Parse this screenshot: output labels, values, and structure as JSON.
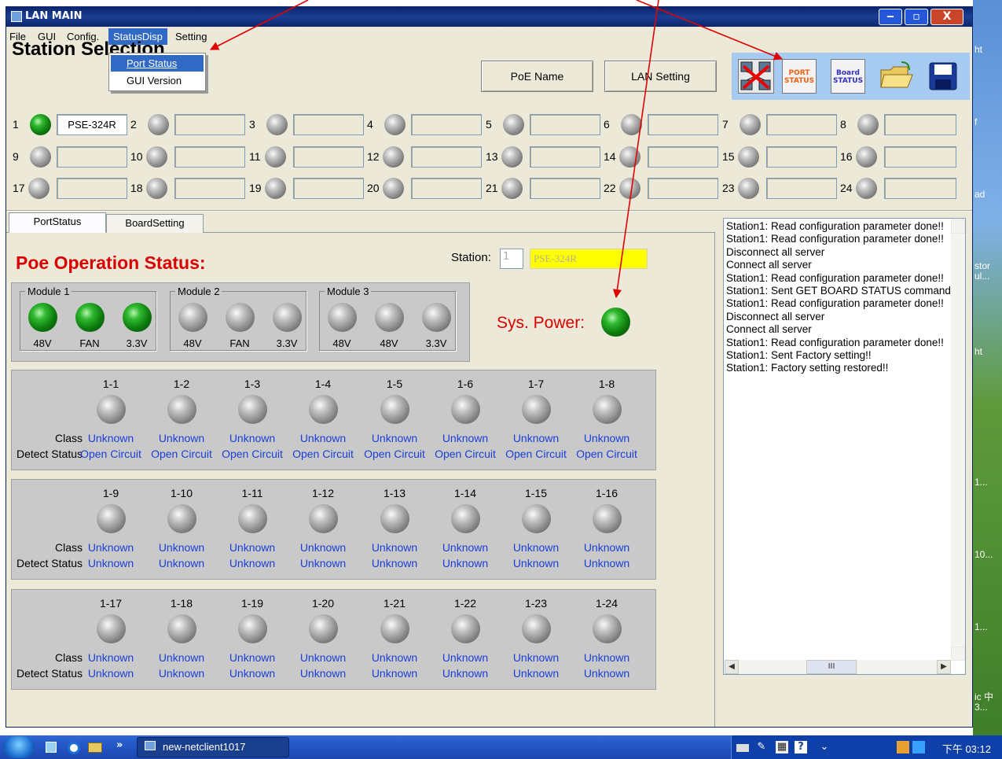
{
  "window": {
    "title": "LAN MAIN",
    "buttons": {
      "minimize": "‒",
      "maximize": "▫",
      "close": "X"
    }
  },
  "menu": {
    "items": [
      {
        "label": "File"
      },
      {
        "label": "GUI"
      },
      {
        "label": "Config."
      },
      {
        "label": "StatusDisp"
      },
      {
        "label": "Setting"
      }
    ],
    "dropdown": [
      {
        "label": "Port Status"
      },
      {
        "label": "GUI Version"
      }
    ]
  },
  "station_selection": {
    "title": "Station Selection",
    "poe_name_button": "PoE Name",
    "lan_setting_button": "LAN Setting",
    "toolbar": {
      "port_status": "PORT STATUS",
      "board_status": "Board STATUS"
    },
    "stations": [
      {
        "num": "1",
        "name": "PSE-324R",
        "on": true
      },
      {
        "num": "2",
        "name": "",
        "on": false
      },
      {
        "num": "3",
        "name": "",
        "on": false
      },
      {
        "num": "4",
        "name": "",
        "on": false
      },
      {
        "num": "5",
        "name": "",
        "on": false
      },
      {
        "num": "6",
        "name": "",
        "on": false
      },
      {
        "num": "7",
        "name": "",
        "on": false
      },
      {
        "num": "8",
        "name": "",
        "on": false
      },
      {
        "num": "9",
        "name": "",
        "on": false
      },
      {
        "num": "10",
        "name": "",
        "on": false
      },
      {
        "num": "11",
        "name": "",
        "on": false
      },
      {
        "num": "12",
        "name": "",
        "on": false
      },
      {
        "num": "13",
        "name": "",
        "on": false
      },
      {
        "num": "14",
        "name": "",
        "on": false
      },
      {
        "num": "15",
        "name": "",
        "on": false
      },
      {
        "num": "16",
        "name": "",
        "on": false
      },
      {
        "num": "17",
        "name": "",
        "on": false
      },
      {
        "num": "18",
        "name": "",
        "on": false
      },
      {
        "num": "19",
        "name": "",
        "on": false
      },
      {
        "num": "20",
        "name": "",
        "on": false
      },
      {
        "num": "21",
        "name": "",
        "on": false
      },
      {
        "num": "22",
        "name": "",
        "on": false
      },
      {
        "num": "23",
        "name": "",
        "on": false
      },
      {
        "num": "24",
        "name": "",
        "on": false
      }
    ]
  },
  "tabs": [
    {
      "label": "PortStatus"
    },
    {
      "label": "BoardSetting"
    }
  ],
  "poe_status": {
    "title": "Poe Operation Status:",
    "station_label": "Station:",
    "station_num": "1",
    "station_name": "PSE-324R",
    "sys_power_label": "Sys. Power:",
    "modules": [
      {
        "name": "Module 1",
        "leds": [
          {
            "label": "48V",
            "on": true
          },
          {
            "label": "FAN",
            "on": true
          },
          {
            "label": "3.3V",
            "on": true
          }
        ]
      },
      {
        "name": "Module 2",
        "leds": [
          {
            "label": "48V",
            "on": false
          },
          {
            "label": "FAN",
            "on": false
          },
          {
            "label": "3.3V",
            "on": false
          }
        ]
      },
      {
        "name": "Module 3",
        "leds": [
          {
            "label": "48V",
            "on": false
          },
          {
            "label": "48V",
            "on": false
          },
          {
            "label": "3.3V",
            "on": false
          }
        ]
      }
    ],
    "row_labels": {
      "class": "Class",
      "detect": "Detect Status"
    },
    "port_groups": [
      {
        "ports": [
          {
            "id": "1-1",
            "class": "Unknown",
            "detect": "Open Circuit"
          },
          {
            "id": "1-2",
            "class": "Unknown",
            "detect": "Open Circuit"
          },
          {
            "id": "1-3",
            "class": "Unknown",
            "detect": "Open Circuit"
          },
          {
            "id": "1-4",
            "class": "Unknown",
            "detect": "Open Circuit"
          },
          {
            "id": "1-5",
            "class": "Unknown",
            "detect": "Open Circuit"
          },
          {
            "id": "1-6",
            "class": "Unknown",
            "detect": "Open Circuit"
          },
          {
            "id": "1-7",
            "class": "Unknown",
            "detect": "Open Circuit"
          },
          {
            "id": "1-8",
            "class": "Unknown",
            "detect": "Open Circuit"
          }
        ]
      },
      {
        "ports": [
          {
            "id": "1-9",
            "class": "Unknown",
            "detect": "Unknown"
          },
          {
            "id": "1-10",
            "class": "Unknown",
            "detect": "Unknown"
          },
          {
            "id": "1-11",
            "class": "Unknown",
            "detect": "Unknown"
          },
          {
            "id": "1-12",
            "class": "Unknown",
            "detect": "Unknown"
          },
          {
            "id": "1-13",
            "class": "Unknown",
            "detect": "Unknown"
          },
          {
            "id": "1-14",
            "class": "Unknown",
            "detect": "Unknown"
          },
          {
            "id": "1-15",
            "class": "Unknown",
            "detect": "Unknown"
          },
          {
            "id": "1-16",
            "class": "Unknown",
            "detect": "Unknown"
          }
        ]
      },
      {
        "ports": [
          {
            "id": "1-17",
            "class": "Unknown",
            "detect": "Unknown"
          },
          {
            "id": "1-18",
            "class": "Unknown",
            "detect": "Unknown"
          },
          {
            "id": "1-19",
            "class": "Unknown",
            "detect": "Unknown"
          },
          {
            "id": "1-20",
            "class": "Unknown",
            "detect": "Unknown"
          },
          {
            "id": "1-21",
            "class": "Unknown",
            "detect": "Unknown"
          },
          {
            "id": "1-22",
            "class": "Unknown",
            "detect": "Unknown"
          },
          {
            "id": "1-23",
            "class": "Unknown",
            "detect": "Unknown"
          },
          {
            "id": "1-24",
            "class": "Unknown",
            "detect": "Unknown"
          }
        ]
      }
    ]
  },
  "log": [
    "Station1: Read configuration parameter done!!",
    "Station1: Read configuration parameter done!!",
    "Disconnect all server",
    "Connect all server",
    "Station1: Read configuration parameter done!!",
    "Station1: Sent GET BOARD STATUS command",
    "Station1: Read configuration parameter done!!",
    "Disconnect all server",
    "Connect all server",
    "Station1: Read configuration parameter done!!",
    "Station1: Sent Factory setting!!",
    "Station1: Factory setting restored!!"
  ],
  "log_hscroll_thumb": "III",
  "taskbar": {
    "task": "new-netclient1017",
    "clock": "下午 03:12",
    "quick_launch_more": "»"
  },
  "desktop_labels": [
    "ht",
    "f",
    "ad",
    "stor ul...",
    "ht",
    "1...",
    "10...",
    "1...",
    "ic 中 3..."
  ],
  "colors": {
    "title_red": "#d80000",
    "port_value_blue": "#1a3fd8",
    "station_name_yellow": "#ffff00",
    "toolbar_panel": "#a6caf0",
    "annotation_arrow": "#e00000"
  }
}
